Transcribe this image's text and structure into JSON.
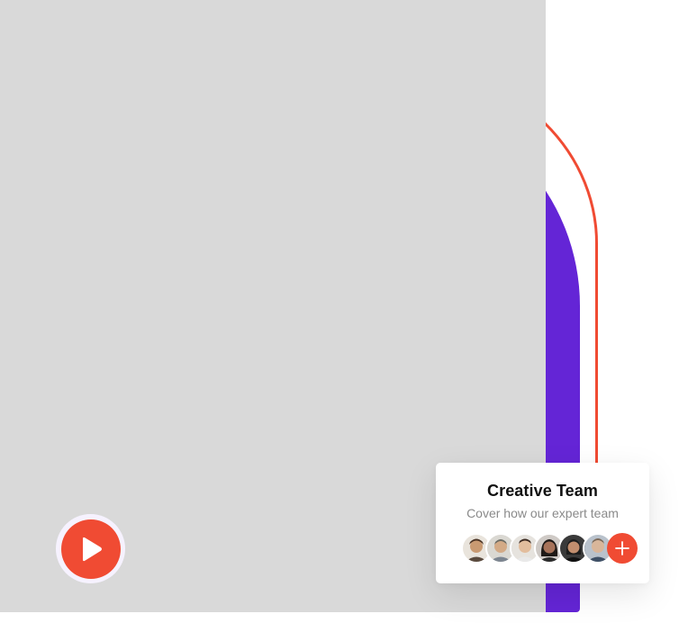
{
  "colors": {
    "accent": "#f04b33",
    "purple": "#6425d6",
    "placeholder": "#d9d9d9",
    "ring": "#f6f2ff"
  },
  "media": {
    "play_icon": "play-icon"
  },
  "team_card": {
    "title": "Creative Team",
    "subtitle": "Cover how our expert team",
    "avatars": [
      {
        "icon": "avatar-1",
        "bg": "#e9e4dc",
        "skin": "#c99a72",
        "hair": "#4a3324"
      },
      {
        "icon": "avatar-2",
        "bg": "#dad8d2",
        "skin": "#d3aa86",
        "hair": "#6b6b63"
      },
      {
        "icon": "avatar-3",
        "bg": "#e6e3de",
        "skin": "#e2bd9d",
        "hair": "#3d2b22"
      },
      {
        "icon": "avatar-4",
        "bg": "#cfcac6",
        "skin": "#a7735a",
        "hair": "#1f1a17"
      },
      {
        "icon": "avatar-5",
        "bg": "#3a3a3a",
        "skin": "#c28e6e",
        "hair": "#1c1c1c"
      },
      {
        "icon": "avatar-6",
        "bg": "#b9c2cc",
        "skin": "#d9b69a",
        "hair": "#7d6a58"
      }
    ],
    "add_icon": "plus-icon"
  }
}
